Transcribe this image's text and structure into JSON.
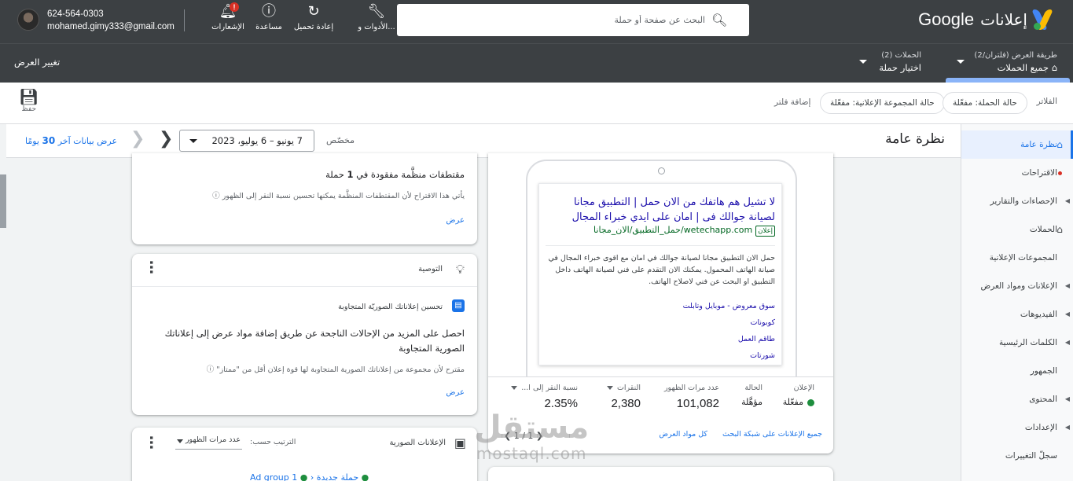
{
  "header": {
    "product_name": "إعلانات",
    "brand": "Google",
    "search_placeholder": "البحث عن صفحة أو حملة",
    "tools_label": "الأدوات و...",
    "reload_label": "إعادة تحميل",
    "help_label": "مساعدة",
    "notifications_label": "الإشعارات",
    "notifications_badge": "!",
    "account_id": "624-564-0303",
    "account_email": "mohamed.gimy333@gmail.com"
  },
  "subbar": {
    "view_small": "طريقة العرض (فلتران/2)",
    "view_value": "جميع الحملات",
    "campaigns_small": "الحملات (2)",
    "campaigns_value": "اختيار حملة",
    "change_view": "تغيير العرض"
  },
  "filters": {
    "label": "الفلاتر",
    "chips": [
      "حالة الحملة: مفعّلة",
      "حالة المجموعة الإعلانية: مفعّلة"
    ],
    "add_filter": "إضافة فلتر",
    "save_label": "حفظ"
  },
  "nav": {
    "items": [
      {
        "label": "نظرة عامة",
        "icon": "home-icon"
      },
      {
        "label": "الاقتراحات",
        "icon": "dot"
      },
      {
        "label": "الإحصاءات والتقارير",
        "expand": true
      },
      {
        "label": "الحملات",
        "icon": "home-icon"
      },
      {
        "label": "المجموعات الإعلانية"
      },
      {
        "label": "الإعلانات ومواد العرض",
        "expand": true
      },
      {
        "label": "الفيديوهات",
        "expand": true
      },
      {
        "label": "الكلمات الرئيسية",
        "expand": true
      },
      {
        "label": "الجمهور"
      },
      {
        "label": "المحتوى",
        "expand": true
      },
      {
        "label": "الإعدادات",
        "expand": true
      },
      {
        "label": "سجلّ التغييرات"
      }
    ]
  },
  "overview": {
    "title": "نظرة عامة",
    "custom_label": "مخصّص",
    "date_range": "7 يونيو – 6 يوليو، 2023",
    "last30_prefix": "عرض بيانات آخر",
    "last30_num": "30",
    "last30_suffix": "يومًا"
  },
  "cards": {
    "sitelinks": {
      "title_prefix": "مقتطفات منظَّمة مفقودة في",
      "title_num": "1",
      "title_suffix": "حملة",
      "desc": "يأتي هذا الاقتراح لأن المقتطفات المنظَّمة يمكنها تحسين نسبة النقر إلى الظهور",
      "link": "عرض"
    },
    "recommendation": {
      "header": "التوصية",
      "subtitle": "تحسين إعلاناتك الصوريّة المتجاوبة",
      "body": "احصل على المزيد من الإحالات الناجحة عن طريق إضافة مواد عرض إلى إعلاناتك الصورية المتجاوبة",
      "note": "مقترح لأن مجموعة من إعلاناتك الصورية المتجاوبة لها قوة إعلان أقل من \"ممتاز\"",
      "link": "عرض"
    },
    "display_ads": {
      "title": "الإعلانات الصورية",
      "sort_label": "الترتيب حسب:",
      "sort_value": "عدد مرات الظهور",
      "ad_group": "Ad group 1",
      "campaign": "حملة جديدة"
    },
    "ad_preview": {
      "headline": "لا تشيل هم هاتفك من الان حمل | التطبيق مجانا لصيانة جوالك فى | امان على ايدي خبراء المجال",
      "ad_tag": "إعلان",
      "url": "wetechapp.com/حمل_التطبيق/الان_مجانا",
      "description": "حمل الان التطبيق مجانا لصيانة جوالك في امان مع اقوى خبراء المجال في صيانة الهاتف المحمول. يمكنك الان التقدم على فني لصيانة الهاتف داخل التطبيق او البحث عن فني لاصلاح الهاتف.",
      "sitelinks": [
        "سوق معروض - موبايل وتابلت",
        "كوبونات",
        "طاقم العمل",
        "شورتات"
      ],
      "stats": {
        "ad_label": "الإعلان",
        "ad_value": "مفعّلة",
        "status_label": "الحالة",
        "status_value": "مؤهَّلة",
        "impr_label": "عدد مرات الظهور",
        "impr_value": "101,082",
        "clicks_label": "النقرات",
        "clicks_value": "2,380",
        "ctr_label": "نسبة النقر إلى ا...",
        "ctr_value": "2.35%"
      },
      "links": [
        "جميع الإعلانات على شبكة البحث",
        "كل مواد العرض"
      ],
      "pager": "1 / 1"
    }
  },
  "watermark": {
    "line1": "مستقل",
    "line2": "mostaql.com"
  },
  "colors": {
    "topbar": "#3c4043",
    "accent": "#1a73e8",
    "active_nav_bg": "#e8f0fe",
    "enabled_green": "#1e8e3e"
  }
}
